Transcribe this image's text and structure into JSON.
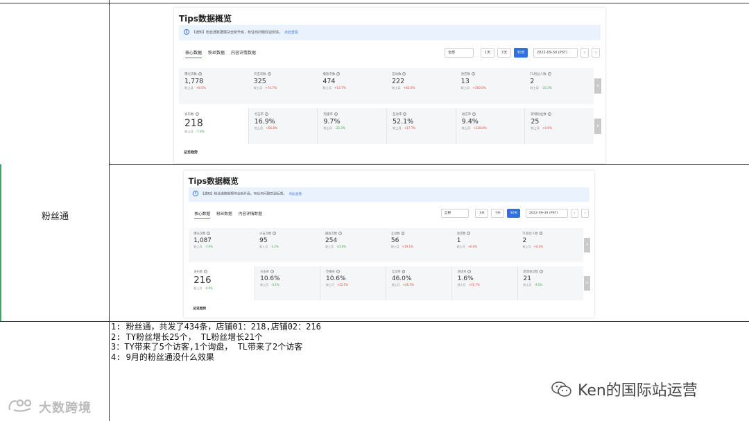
{
  "row_label": "粉丝通",
  "panels": [
    {
      "title": "Tips数据概览",
      "notice": "【通知】粉丝通数据模块全新升级，有任何问题欢迎反馈。",
      "notice_link": "点此查看",
      "tabs": [
        "核心数据",
        "粉丝数据",
        "内容详情数据"
      ],
      "select_value": "全部",
      "range_buttons": [
        "1天",
        "7天",
        "30天"
      ],
      "active_range": "30天",
      "date_value": "2022-09-30 (PST)",
      "compare_label": "较上月",
      "row1": [
        {
          "label": "曝光次数",
          "value": "1,778",
          "change": "+8.5%",
          "dir": "up"
        },
        {
          "label": "点击次数",
          "value": "325",
          "change": "+74.7%",
          "dir": "up"
        },
        {
          "label": "播放次数",
          "value": "474",
          "change": "+13.7%",
          "dir": "up"
        },
        {
          "label": "互动数",
          "value": "222",
          "change": "+82.0%",
          "dir": "up"
        },
        {
          "label": "进店数",
          "value": "13",
          "change": "+160.0%",
          "dir": "up"
        },
        {
          "label": "TL粉丝人数",
          "value": "2",
          "change": "-33.3%",
          "dir": "down"
        }
      ],
      "row2": [
        {
          "label": "发布数",
          "value": "218",
          "change": "-7.8%",
          "dir": "down"
        },
        {
          "label": "点击率",
          "value": "16.9%",
          "change": "+56.8%",
          "dir": "up"
        },
        {
          "label": "完播率",
          "value": "9.7%",
          "change": "-33.3%",
          "dir": "down"
        },
        {
          "label": "互动率",
          "value": "52.1%",
          "change": "+17.7%",
          "dir": "up"
        },
        {
          "label": "进店率",
          "value": "9.4%",
          "change": "+128.8%",
          "dir": "up"
        },
        {
          "label": "新增粉丝数",
          "value": "25",
          "change": "+0.0%",
          "dir": "up"
        }
      ],
      "trend_label": "总览趋势"
    },
    {
      "title": "Tips数据概览",
      "notice": "【通知】粉丝通数据模块全新升级，有任何问题欢迎反馈。",
      "notice_link": "点此查看",
      "tabs": [
        "核心数据",
        "粉丝数据",
        "内容详情数据"
      ],
      "select_value": "全部",
      "range_buttons": [
        "1天",
        "7天",
        "30天"
      ],
      "active_range": "30天",
      "date_value": "2022-09-30 (PST)",
      "compare_label": "较上月",
      "row1": [
        {
          "label": "曝光次数",
          "value": "1,087",
          "change": "-7.0%",
          "dir": "down"
        },
        {
          "label": "点击次数",
          "value": "95",
          "change": "-3.2%",
          "dir": "down"
        },
        {
          "label": "播放次数",
          "value": "254",
          "change": "-23.9%",
          "dir": "down"
        },
        {
          "label": "互动数",
          "value": "56",
          "change": "+19.1%",
          "dir": "up"
        },
        {
          "label": "进店数",
          "value": "1",
          "change": "+0.0%",
          "dir": "up"
        },
        {
          "label": "TL粉丝人数",
          "value": "2",
          "change": "+0.0%",
          "dir": "up"
        }
      ],
      "row2": [
        {
          "label": "发布数",
          "value": "216",
          "change": "-0.9%",
          "dir": "down"
        },
        {
          "label": "点击率",
          "value": "10.6%",
          "change": "-4.1%",
          "dir": "down"
        },
        {
          "label": "完播率",
          "value": "10.6%",
          "change": "+12.5%",
          "dir": "up"
        },
        {
          "label": "互动率",
          "value": "46.0%",
          "change": "+26.5%",
          "dir": "up"
        },
        {
          "label": "进店率",
          "value": "1.6%",
          "change": "+31.7%",
          "dir": "up"
        },
        {
          "label": "新增粉丝数",
          "value": "21",
          "change": "-4.5%",
          "dir": "down"
        }
      ],
      "trend_label": "总览趋势"
    }
  ],
  "notes": [
    "1: 粉丝通，共发了434条，店铺01：218,店铺02：216",
    "2: TY粉丝增长25个， TL粉丝增长21个",
    "3：TY带来了5个访客,1个询盘，  TL带来了2个访客",
    "4: 9月的粉丝通没什么效果"
  ],
  "watermark_right": "Ken的国际站运营",
  "watermark_left": "大数跨境",
  "colors": {
    "accent": "#2f6fe0",
    "up": "#e0453a",
    "down": "#3aa84a",
    "left_bar": "#3aa86a"
  }
}
